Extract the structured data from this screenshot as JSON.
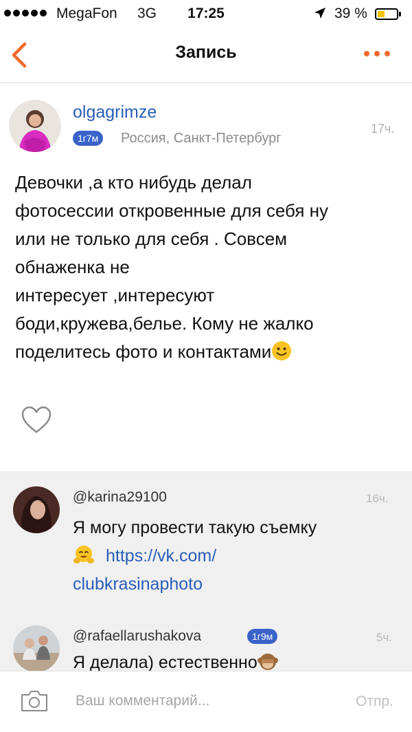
{
  "status_bar": {
    "carrier": "MegaFon",
    "network": "3G",
    "time": "17:25",
    "battery": "39 %",
    "battery_level": 0.39,
    "battery_color": "#f5c400"
  },
  "nav": {
    "title": "Запись",
    "accent_color": "#f06a2c",
    "back_icon": "chevron-left-icon",
    "more_icon": "more-dots-icon"
  },
  "post": {
    "author": "olgagrimze",
    "badge": "1г7м",
    "location": "Россия, Санкт-Петербург",
    "time": "17ч.",
    "text": "Девочки ,а кто нибудь делал\nфотосессии откровенные для себя ну\nили не только для себя . Совсем\nобнаженка не\nинтересует ,интересуют\nбоди,кружева,белье. Кому не жалко\nподелитесь фото и контактами",
    "like_icon": "heart-outline-icon"
  },
  "comments": [
    {
      "author": "@karina29100",
      "time": "16ч.",
      "text": "Я могу провести такую съемку",
      "link": "https://vk.com/\nclubkrasinaphoto"
    },
    {
      "author": "@rafaellarushakova",
      "badge": "1г9м",
      "time": "5ч.",
      "text": "Я делала) естественно"
    }
  ],
  "composer": {
    "placeholder": "Ваш комментарий...",
    "send_label": "Отпр.",
    "camera_icon": "camera-icon"
  }
}
